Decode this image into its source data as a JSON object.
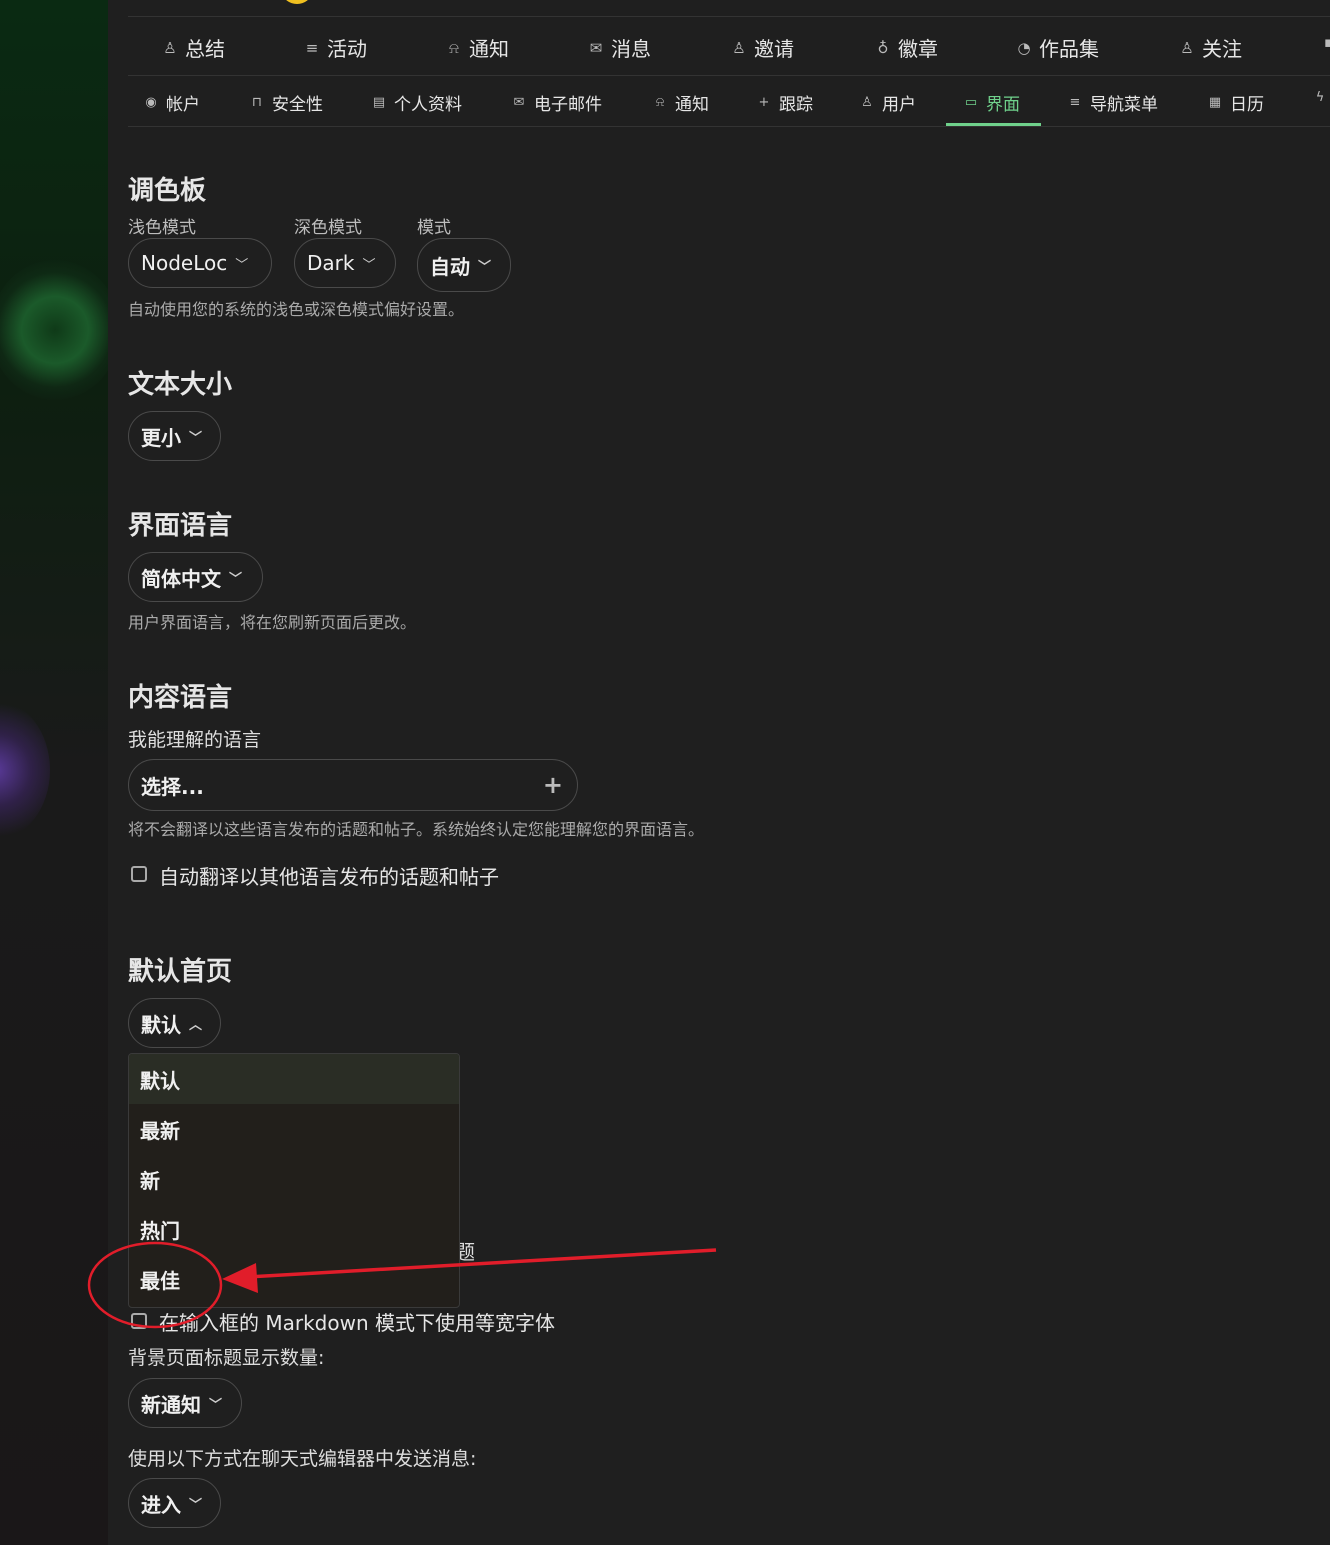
{
  "nav_primary": [
    {
      "label": "总结",
      "icon": "user-icon"
    },
    {
      "label": "活动",
      "icon": "list-icon"
    },
    {
      "label": "通知",
      "icon": "bell-icon"
    },
    {
      "label": "消息",
      "icon": "mail-icon"
    },
    {
      "label": "邀请",
      "icon": "user-plus-icon"
    },
    {
      "label": "徽章",
      "icon": "badge-icon"
    },
    {
      "label": "作品集",
      "icon": "palette-icon"
    },
    {
      "label": "关注",
      "icon": "users-icon"
    }
  ],
  "nav_secondary": [
    {
      "label": "帐户",
      "icon": "user-circle-icon"
    },
    {
      "label": "安全性",
      "icon": "lock-icon"
    },
    {
      "label": "个人资料",
      "icon": "id-card-icon"
    },
    {
      "label": "电子邮件",
      "icon": "mail-icon"
    },
    {
      "label": "通知",
      "icon": "bell-icon"
    },
    {
      "label": "跟踪",
      "icon": "plus-icon"
    },
    {
      "label": "用户",
      "icon": "users-icon"
    },
    {
      "label": "界面",
      "icon": "monitor-icon",
      "active": true
    },
    {
      "label": "导航菜单",
      "icon": "menu-icon"
    },
    {
      "label": "日历",
      "icon": "calendar-icon"
    }
  ],
  "accent_color": "#6fd18b",
  "annotation_color": "#e11d2a",
  "palette": {
    "title": "调色板",
    "light_label": "浅色模式",
    "light_value": "NodeLoc",
    "dark_label": "深色模式",
    "dark_value": "Dark",
    "mode_label": "模式",
    "mode_value": "自动",
    "help": "自动使用您的系统的浅色或深色模式偏好设置。"
  },
  "text_size": {
    "title": "文本大小",
    "value": "更小"
  },
  "ui_language": {
    "title": "界面语言",
    "value": "简体中文",
    "help": "用户界面语言，将在您刷新页面后更改。"
  },
  "content_language": {
    "title": "内容语言",
    "label": "我能理解的语言",
    "placeholder": "选择...",
    "help": "将不会翻译以这些语言发布的话题和帖子。系统始终认定您能理解您的界面语言。",
    "auto_translate": "自动翻译以其他语言发布的话题和帖子"
  },
  "default_home": {
    "title": "默认首页",
    "value": "默认",
    "options": [
      "默认",
      "最新",
      "新",
      "热门",
      "最佳"
    ]
  },
  "hidden_partial": "题",
  "monospace_markdown": "在输入框的 Markdown 模式下使用等宽字体",
  "bg_title_count": {
    "label": "背景页面标题显示数量:",
    "value": "新通知"
  },
  "chat_send": {
    "label": "使用以下方式在聊天式编辑器中发送消息:",
    "value": "进入"
  }
}
